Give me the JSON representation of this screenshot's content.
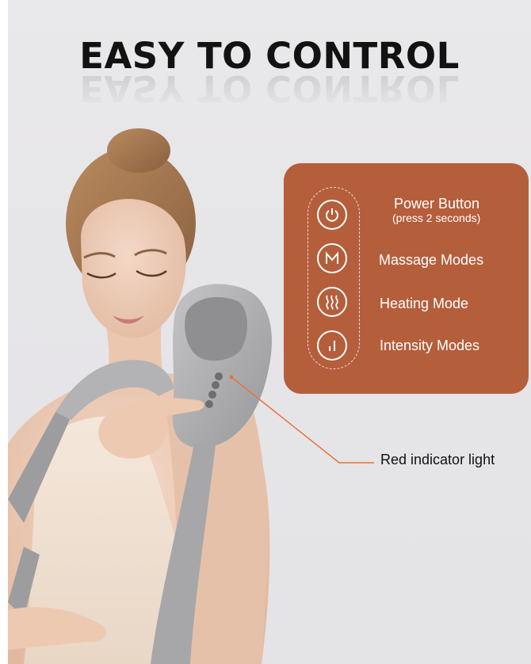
{
  "header": {
    "title": "EASY TO CONTROL"
  },
  "controls": [
    {
      "label": "Power Button",
      "sublabel": "(press 2 seconds)",
      "icon": "power-icon"
    },
    {
      "label": "Massage Modes",
      "icon": "massage-mode-m-icon"
    },
    {
      "label": "Heating Mode",
      "icon": "heat-waves-icon"
    },
    {
      "label": "Intensity Modes",
      "icon": "intensity-bars-icon"
    }
  ],
  "callout": {
    "label": "Red indicator light"
  },
  "colors": {
    "panel": "#b55e3c",
    "callout_line": "#e8733a",
    "device": "#a9a9ab",
    "background": "#e7e6e9"
  }
}
